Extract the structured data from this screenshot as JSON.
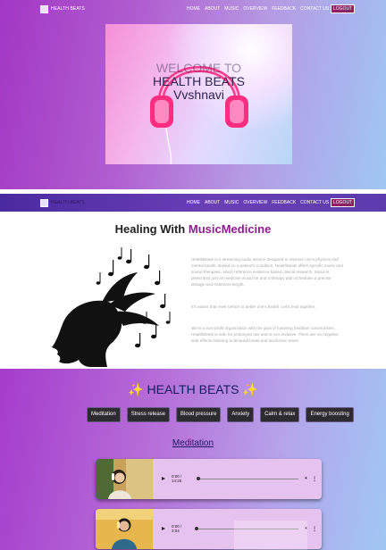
{
  "hero": {
    "nav": {
      "brand": "HEALTH BEATS",
      "links": [
        "HOME",
        "ABOUT",
        "MUSIC",
        "OVERVIEW",
        "FEEDBACK",
        "CONTACT US"
      ],
      "logout": "LOGOUT"
    },
    "title_line1": "WELCOME TO",
    "title_line2": "HEALTH BEATS",
    "title_line3": "Vvshnavi"
  },
  "about": {
    "nav": {
      "brand": "HEALTH BEATS",
      "links": [
        "HOME",
        "ABOUT",
        "MUSIC",
        "OVERVIEW",
        "FEEDBACK",
        "CONTACT US"
      ],
      "logout": "LOGOUT"
    },
    "heading_plain": "Healing With",
    "heading_accent": "MusicMedicine",
    "paragraphs": [
      "HealthBeats is a streaming audio service designed to improve one's physical and mental health. Based on a patient's condition, Healthbeats offers specific music and sound therapies, which reference evidence based clinical research. Music is prescribed just as medicine would be and a therapy plan schedules a precise dosage and treatment length.",
      "It's easier than ever before to better one's health. Let's heal together.",
      "We're a non-profit organization with the goal of fostering healthier communities. HealthBeats is safe for prolonged use and is non-invasive. There are no negative side effects listening to binaural beats and isochronic tones."
    ]
  },
  "music": {
    "title": "HEALTH BEATS",
    "categories": [
      "Meditation",
      "Stress release",
      "Blood pressure",
      "Anxiety",
      "Calm & relax",
      "Energy boosting"
    ],
    "section_title": "Meditation",
    "tracks": [
      {
        "time": "0:00 / 14:25"
      },
      {
        "time": "0:00 / 3:04"
      }
    ]
  },
  "colors": {
    "accent": "#8f1c8f",
    "nav_dark": "#4a2aa0",
    "logout_bg": "#8e1f64",
    "card_bg": "#e6c2ee",
    "category_bg": "#2b2b30"
  }
}
